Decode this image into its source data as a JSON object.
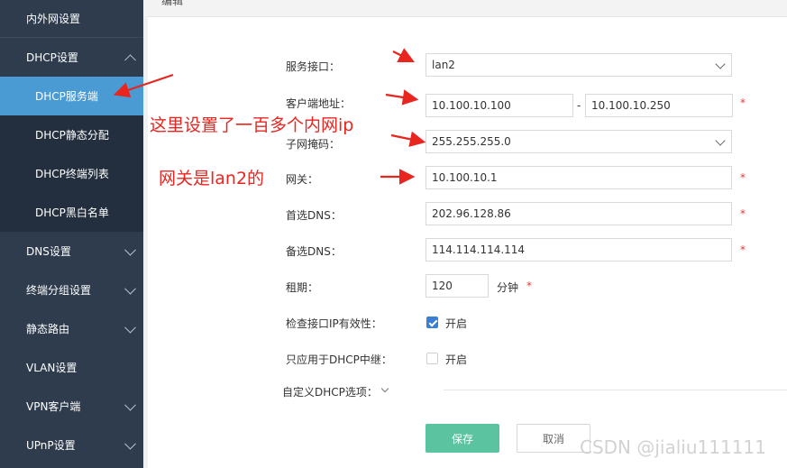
{
  "header": {
    "title": "编辑"
  },
  "sidebar": {
    "items": [
      {
        "label": "内外网设置"
      },
      {
        "label": "DHCP设置"
      },
      {
        "label": "DHCP服务端"
      },
      {
        "label": "DHCP静态分配"
      },
      {
        "label": "DHCP终端列表"
      },
      {
        "label": "DHCP黑白名单"
      },
      {
        "label": "DNS设置"
      },
      {
        "label": "终端分组设置"
      },
      {
        "label": "静态路由"
      },
      {
        "label": "VLAN设置"
      },
      {
        "label": "VPN客户端"
      },
      {
        "label": "UPnP设置"
      }
    ]
  },
  "form": {
    "interface": {
      "label": "服务接口：",
      "value": "lan2"
    },
    "client_address": {
      "label": "客户端地址：",
      "start": "10.100.10.100",
      "separator": "-",
      "end": "10.100.10.250"
    },
    "subnet_mask": {
      "label": "子网掩码：",
      "value": "255.255.255.0"
    },
    "gateway": {
      "label": "网关：",
      "value": "10.100.10.1"
    },
    "primary_dns": {
      "label": "首选DNS：",
      "value": "202.96.128.86"
    },
    "secondary_dns": {
      "label": "备选DNS：",
      "value": "114.114.114.114"
    },
    "lease": {
      "label": "租期：",
      "value": "120",
      "unit": "分钟"
    },
    "check_ip": {
      "label": "检查接口IP有效性：",
      "option": "开启",
      "checked": true
    },
    "relay_only": {
      "label": "只应用于DHCP中继：",
      "option": "开启",
      "checked": false
    },
    "custom_options": {
      "label": "自定义DHCP选项："
    },
    "required_mark": "*"
  },
  "buttons": {
    "save": "保存",
    "cancel": "取消"
  },
  "annotations": {
    "note_ip_count": "这里设置了一百多个内网ip",
    "note_gateway": "网关是lan2的",
    "color": "#e8251f"
  },
  "watermark": "CSDN @jialiu111111"
}
